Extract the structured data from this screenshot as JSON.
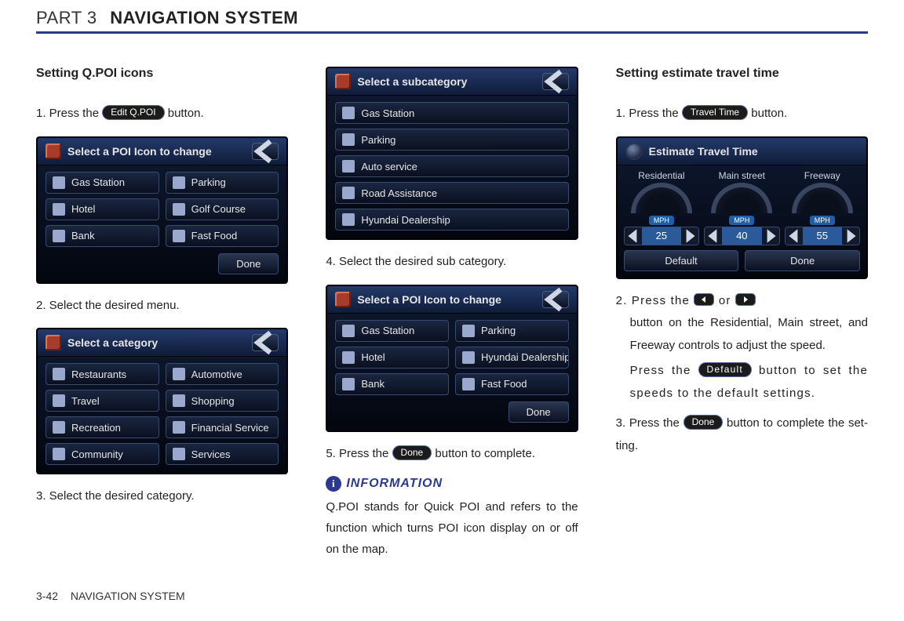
{
  "header": {
    "part": "PART 3",
    "title": "NAVIGATION SYSTEM"
  },
  "footer": {
    "page": "3-42",
    "label": "NAVIGATION SYSTEM"
  },
  "col1": {
    "heading": "Setting Q.POI icons",
    "step1_a": "1. Press the ",
    "step1_btn": "Edit Q.POI",
    "step1_b": " button.",
    "shot1": {
      "title": "Select a POI Icon to change",
      "items": [
        "Gas Station",
        "Parking",
        "Hotel",
        "Golf Course",
        "Bank",
        "Fast Food"
      ],
      "done": "Done"
    },
    "step2": "2. Select the desired menu.",
    "shot2": {
      "title": "Select a category",
      "items": [
        "Restaurants",
        "Automotive",
        "Travel",
        "Shopping",
        "Recreation",
        "Financial Service",
        "Community",
        "Services"
      ]
    },
    "step3": "3. Select the desired category."
  },
  "col2": {
    "shot3": {
      "title": "Select a subcategory",
      "items": [
        "Gas Station",
        "Parking",
        "Auto service",
        "Road Assistance",
        "Hyundai Dealership"
      ]
    },
    "step4": "4. Select the desired sub category.",
    "shot4": {
      "title": "Select a POI Icon to change",
      "items": [
        "Gas Station",
        "Parking",
        "Hotel",
        "Hyundai Dealership",
        "Bank",
        "Fast Food"
      ],
      "done": "Done"
    },
    "step5_a": "5. Press the ",
    "step5_btn": "Done",
    "step5_b": " button to complete.",
    "info_label": "INFORMATION",
    "info_body": "Q.POI stands for Quick POI and refers to the function which turns POI icon display on or off on the map."
  },
  "col3": {
    "heading": "Setting estimate travel time",
    "step1_a": "1. Press the ",
    "step1_btn": "Travel Time",
    "step1_b": " button.",
    "shot5": {
      "title": "Estimate Travel Time",
      "gauges": [
        {
          "label": "Residential",
          "unit": "MPH",
          "value": "25"
        },
        {
          "label": "Main street",
          "unit": "MPH",
          "value": "40"
        },
        {
          "label": "Freeway",
          "unit": "MPH",
          "value": "55"
        }
      ],
      "default": "Default",
      "done": "Done"
    },
    "step2_a": "2. Press the ",
    "step2_b": " or ",
    "step2_c": " button on the Residential, Main street, and Freeway con­trols to adjust the speed.",
    "step2_d": "Press the ",
    "step2_def": "Default",
    "step2_e": " button to set the speeds to the default settings.",
    "step3_a": "3. Press the ",
    "step3_btn": "Done",
    "step3_b": " button to complete the set­ting."
  }
}
